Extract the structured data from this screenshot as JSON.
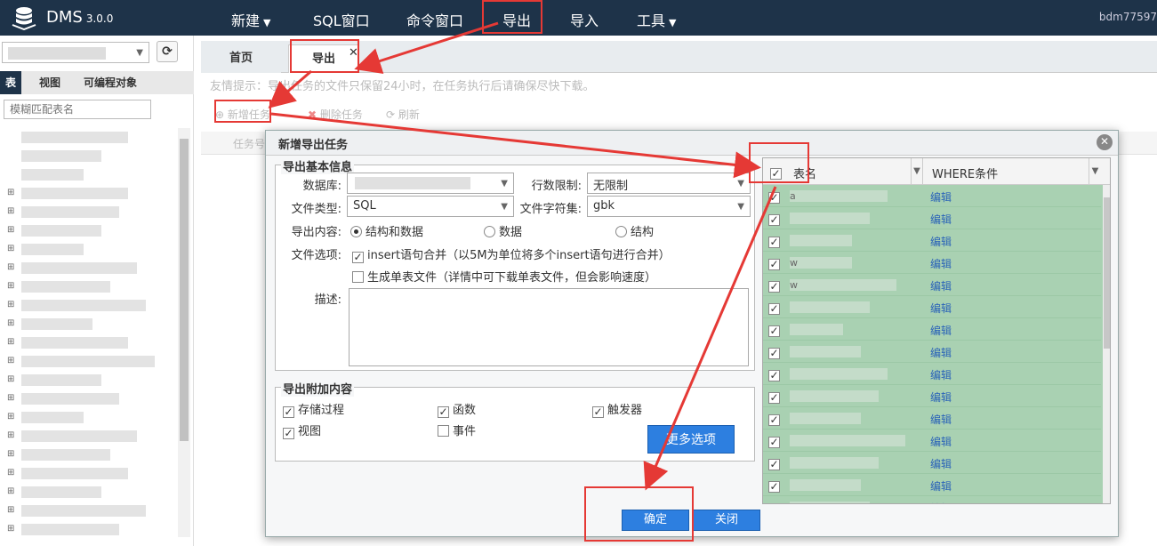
{
  "app": {
    "name": "DMS",
    "version": "3.0.0",
    "user": "bdm77597"
  },
  "menu": [
    {
      "label": "新建",
      "dropdown": true
    },
    {
      "label": "SQL窗口",
      "dropdown": false
    },
    {
      "label": "命令窗口",
      "dropdown": false
    },
    {
      "label": "导出",
      "dropdown": false
    },
    {
      "label": "导入",
      "dropdown": false
    },
    {
      "label": "工具",
      "dropdown": true
    }
  ],
  "sidebar": {
    "tabs": [
      "表",
      "视图",
      "可编程对象"
    ],
    "search_placeholder": "模糊匹配表名"
  },
  "main": {
    "tabs": [
      "首页",
      "导出"
    ],
    "tip": "友情提示：导出任务的文件只保留24小时，在任务执行后请确保尽快下载。",
    "toolbar": {
      "new_task": "新增任务",
      "delete_task": "删除任务",
      "refresh": "刷新"
    },
    "grid_header": "任务号"
  },
  "dialog": {
    "title": "新增导出任务",
    "basic_section": "导出基本信息",
    "db_label": "数据库:",
    "row_limit_label": "行数限制:",
    "row_limit_value": "无限制",
    "file_type_label": "文件类型:",
    "file_type_value": "SQL",
    "charset_label": "文件字符集:",
    "charset_value": "gbk",
    "content_label": "导出内容:",
    "content_options": [
      "结构和数据",
      "数据",
      "结构"
    ],
    "file_options_label": "文件选项:",
    "file_option_1": "insert语句合并（以5M为单位将多个insert语句进行合并）",
    "file_option_2": "生成单表文件（详情中可下载单表文件，但会影响速度）",
    "desc_label": "描述:",
    "extra_section": "导出附加内容",
    "extras": [
      {
        "label": "存储过程",
        "checked": true
      },
      {
        "label": "函数",
        "checked": true
      },
      {
        "label": "触发器",
        "checked": true
      },
      {
        "label": "视图",
        "checked": true
      },
      {
        "label": "事件",
        "checked": false
      }
    ],
    "more_button": "更多选项",
    "table_header_name": "表名",
    "table_header_where": "WHERE条件",
    "row_action": "编辑",
    "row_name_fragments": [
      "a",
      "",
      "",
      "w",
      "w",
      "",
      "",
      "",
      "",
      "",
      "",
      "",
      "",
      "",
      ""
    ],
    "ok_button": "确定",
    "close_button": "关闭"
  },
  "colors": {
    "navbar": "#1e3349",
    "accent": "#2d7fe0",
    "highlight": "#e53935",
    "table_row": "#a9d1b2"
  }
}
